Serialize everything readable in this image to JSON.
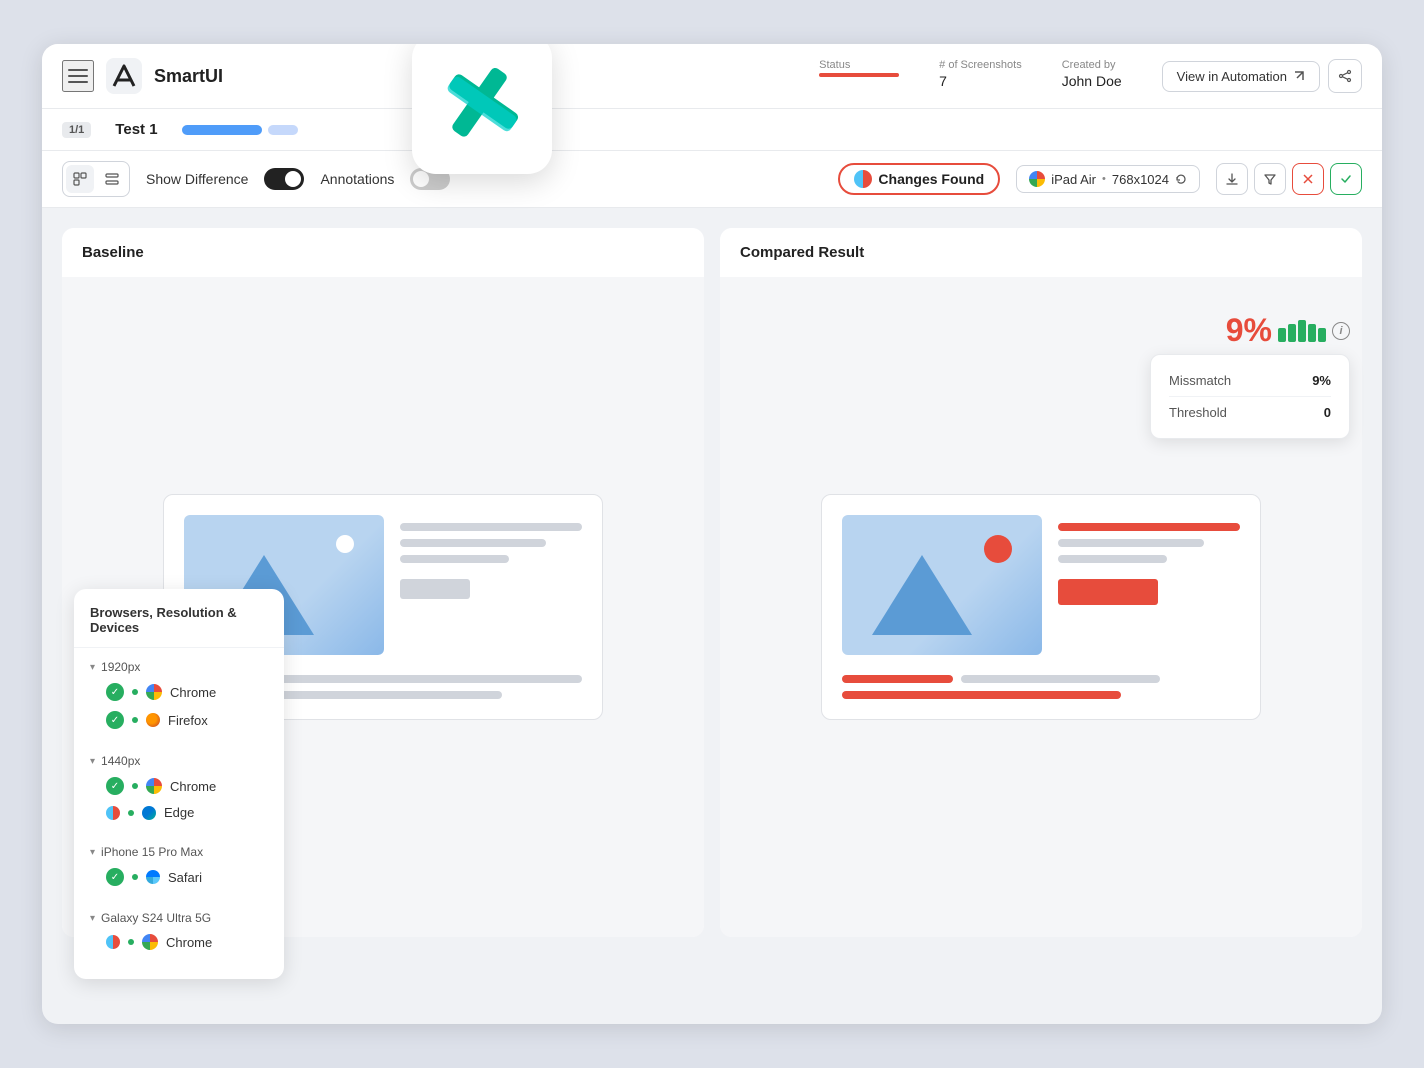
{
  "app": {
    "title": "SmartUI",
    "logo_alt": "smartui-logo"
  },
  "header": {
    "test_badge": "1/1",
    "test_name": "Test 1",
    "status_label": "Status",
    "screenshots_label": "# of Screenshots",
    "screenshots_count": "7",
    "created_by_label": "Created by",
    "created_by_value": "John Doe",
    "view_automation_btn": "View in Automation",
    "share_btn_label": "share"
  },
  "toolbar": {
    "show_diff_label": "Show Difference",
    "annotations_label": "Annotations",
    "changes_found_label": "Changes Found",
    "device_label": "iPad Air",
    "resolution": "768x1024",
    "download_label": "download",
    "delete_label": "delete",
    "close_label": "close",
    "accept_label": "accept"
  },
  "panels": {
    "baseline_title": "Baseline",
    "compared_title": "Compared Result"
  },
  "mismatch": {
    "percentage": "9%",
    "label": "Missmatch",
    "value": "9%",
    "threshold_label": "Threshold",
    "threshold_value": "0"
  },
  "dropdown": {
    "title": "Browsers, Resolution & Devices",
    "groups": [
      {
        "resolution": "1920px",
        "browsers": [
          {
            "name": "Chrome",
            "status": "green"
          },
          {
            "name": "Firefox",
            "status": "green"
          }
        ]
      },
      {
        "resolution": "1440px",
        "browsers": [
          {
            "name": "Chrome",
            "status": "green"
          },
          {
            "name": "Edge",
            "status": "mixed"
          }
        ]
      },
      {
        "resolution": "iPhone 15 Pro Max",
        "browsers": [
          {
            "name": "Safari",
            "status": "green"
          }
        ]
      },
      {
        "resolution": "Galaxy S24 Ultra 5G",
        "browsers": [
          {
            "name": "Chrome",
            "status": "mixed"
          }
        ]
      }
    ]
  }
}
